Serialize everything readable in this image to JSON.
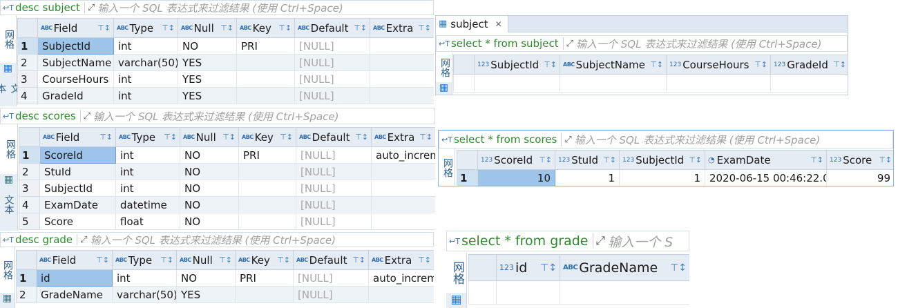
{
  "filter_placeholder": "输入一个 SQL 表达式来过滤结果 (使用 Ctrl+Space)",
  "side_tabs": {
    "grid": "网格",
    "text": "文本"
  },
  "panels": {
    "desc_subject": {
      "sql": "desc subject",
      "columns": [
        "Field",
        "Type",
        "Null",
        "Key",
        "Default",
        "Extra"
      ],
      "rows": [
        [
          "1",
          "SubjectId",
          "int",
          "NO",
          "PRI",
          "[NULL]",
          ""
        ],
        [
          "2",
          "SubjectName",
          "varchar(50)",
          "YES",
          "",
          "[NULL]",
          ""
        ],
        [
          "3",
          "CourseHours",
          "int",
          "YES",
          "",
          "[NULL]",
          ""
        ],
        [
          "4",
          "GradeId",
          "int",
          "YES",
          "",
          "[NULL]",
          ""
        ]
      ]
    },
    "desc_scores": {
      "sql": "desc scores",
      "columns": [
        "Field",
        "Type",
        "Null",
        "Key",
        "Default",
        "Extra"
      ],
      "rows": [
        [
          "1",
          "ScoreId",
          "int",
          "NO",
          "PRI",
          "[NULL]",
          "auto_increm"
        ],
        [
          "2",
          "StuId",
          "int",
          "NO",
          "",
          "[NULL]",
          ""
        ],
        [
          "3",
          "SubjectId",
          "int",
          "NO",
          "",
          "[NULL]",
          ""
        ],
        [
          "4",
          "ExamDate",
          "datetime",
          "NO",
          "",
          "[NULL]",
          ""
        ],
        [
          "5",
          "Score",
          "float",
          "NO",
          "",
          "[NULL]",
          ""
        ]
      ]
    },
    "desc_grade": {
      "sql": "desc grade",
      "columns": [
        "Field",
        "Type",
        "Null",
        "Key",
        "Default",
        "Extra"
      ],
      "rows": [
        [
          "1",
          "id",
          "int",
          "NO",
          "PRI",
          "[NULL]",
          "auto_increm"
        ],
        [
          "2",
          "GradeName",
          "varchar(50)",
          "YES",
          "",
          "[NULL]",
          ""
        ]
      ]
    },
    "select_subject": {
      "tab_label": "subject",
      "sql": "select * from subject",
      "columns": [
        "SubjectId",
        "SubjectName",
        "CourseHours",
        "GradeId"
      ]
    },
    "select_scores": {
      "sql": "select * from scores",
      "columns": [
        "ScoreId",
        "StuId",
        "SubjectId",
        "ExamDate",
        "Score"
      ],
      "rows": [
        [
          "1",
          "10",
          "1",
          "1",
          "2020-06-15 00:46:22.0",
          "99"
        ]
      ]
    },
    "select_grade": {
      "sql": "select * from grade",
      "placeholder_short": "输入一个 S",
      "columns": [
        "id",
        "GradeName"
      ]
    }
  }
}
